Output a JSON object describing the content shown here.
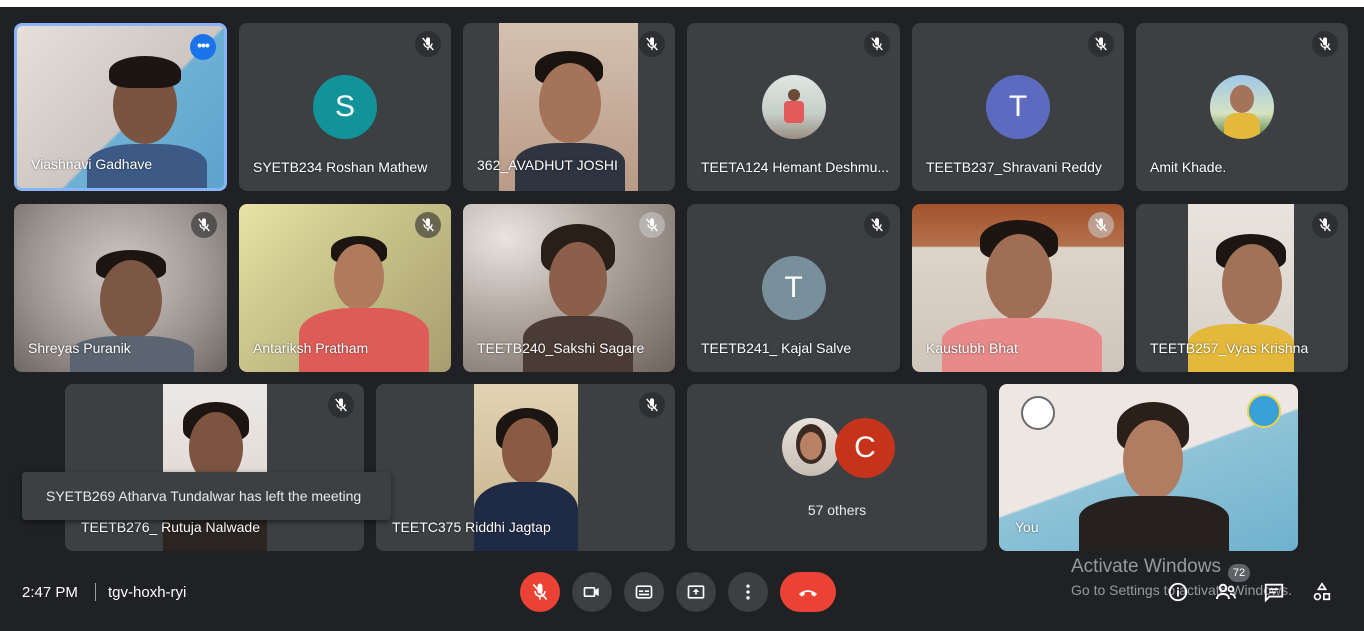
{
  "participants": [
    {
      "name": "Viashnavi Gadhave"
    },
    {
      "name": "SYETB234 Roshan Mathew",
      "initial": "S",
      "color": "#12939a"
    },
    {
      "name": "362_AVADHUT JOSHI"
    },
    {
      "name": "TEETA124 Hemant Deshmu..."
    },
    {
      "name": "TEETB237_Shravani Reddy",
      "initial": "T",
      "color": "#5c6bc0"
    },
    {
      "name": "Amit Khade."
    },
    {
      "name": "Shreyas Puranik"
    },
    {
      "name": "Antariksh Pratham"
    },
    {
      "name": "TEETB240_Sakshi Sagare"
    },
    {
      "name": "TEETB241_ Kajal Salve",
      "initial": "T",
      "color": "#78909c"
    },
    {
      "name": "Kaustubh Bhat"
    },
    {
      "name": "TEETB257_Vyas Krishna"
    },
    {
      "name": "TEETB276_ Rutuja Nalwade"
    },
    {
      "name": "TEETC375 Riddhi Jagtap"
    },
    {
      "name": "You"
    }
  ],
  "others": {
    "initial": "C",
    "color": "#c5331a",
    "label": "57 others"
  },
  "toast": "SYETB269 Atharva Tundalwar has left the meeting",
  "meeting": {
    "time": "2:47 PM",
    "code": "tgv-hoxh-ryi"
  },
  "people_count": "72",
  "watermark": {
    "line1": "Activate Windows",
    "line2": "Go to Settings to activate Windows."
  },
  "icons": {
    "mute": "mic-off-icon",
    "more": "more-horiz-icon",
    "camera": "videocam-icon",
    "captions": "closed-caption-icon",
    "present": "present-screen-icon",
    "options": "more-vert-icon",
    "leave": "call-end-icon",
    "info": "info-icon",
    "people": "people-icon",
    "chat": "chat-icon",
    "activities": "activities-icon"
  }
}
